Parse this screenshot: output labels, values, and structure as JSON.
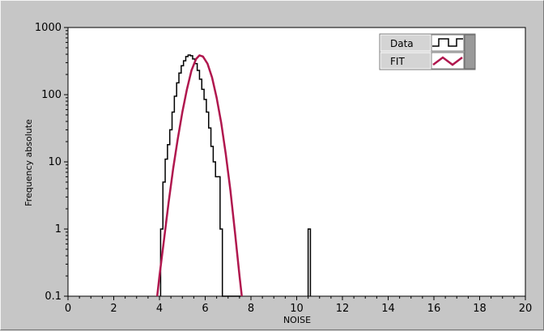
{
  "chart_data": {
    "type": "line",
    "title": "",
    "xlabel": "NOISE",
    "ylabel": "Frequency absolute",
    "xlim": [
      0,
      20
    ],
    "ylim": [
      0.1,
      1000
    ],
    "yscale": "log",
    "grid": false,
    "legend_position": "top-right",
    "x_ticks": [
      0,
      2,
      4,
      6,
      8,
      10,
      12,
      14,
      16,
      18,
      20
    ],
    "y_ticks": [
      0.1,
      1,
      10,
      100,
      1000
    ],
    "x_tick_labels": [
      "0",
      "2",
      "4",
      "6",
      "8",
      "10",
      "12",
      "14",
      "16",
      "18",
      "20"
    ],
    "y_tick_labels": [
      "0.1",
      "1",
      "10",
      "100",
      "1000"
    ],
    "series": [
      {
        "name": "Data",
        "style": "step",
        "color": "#000000",
        "x": [
          4.1,
          4.2,
          4.3,
          4.4,
          4.5,
          4.6,
          4.7,
          4.8,
          4.9,
          5.0,
          5.1,
          5.2,
          5.3,
          5.4,
          5.5,
          5.6,
          5.7,
          5.8,
          5.9,
          6.0,
          6.1,
          6.2,
          6.3,
          6.4,
          6.5,
          6.6,
          6.7,
          6.8,
          6.9,
          7.0,
          7.1,
          7.2,
          7.3,
          7.4,
          7.5
        ],
        "y": [
          1,
          5,
          11,
          18,
          30,
          55,
          95,
          150,
          210,
          270,
          320,
          370,
          390,
          380,
          340,
          290,
          230,
          170,
          120,
          85,
          55,
          32,
          17,
          10,
          6,
          6,
          1,
          0.1,
          0.1,
          0.1,
          0.1,
          0.1,
          0.1,
          0.1,
          0.1
        ],
        "outliers": [
          {
            "x": 10.55,
            "y": 1
          }
        ]
      },
      {
        "name": "FIT",
        "style": "line",
        "color": "#b0174e",
        "x": [
          3.9,
          4.0,
          4.2,
          4.4,
          4.6,
          4.8,
          5.0,
          5.2,
          5.4,
          5.6,
          5.75,
          5.9,
          6.1,
          6.3,
          6.5,
          6.7,
          6.9,
          7.1,
          7.3,
          7.5,
          7.6
        ],
        "y": [
          0.1,
          0.2,
          0.7,
          2.5,
          8,
          22,
          55,
          120,
          230,
          340,
          385,
          370,
          290,
          180,
          90,
          38,
          13,
          3.8,
          0.9,
          0.2,
          0.1
        ]
      }
    ]
  },
  "legend": {
    "items": [
      {
        "label": "Data",
        "icon": "step-line-icon",
        "color": "#000000"
      },
      {
        "label": "FIT",
        "icon": "zigzag-line-icon",
        "color": "#b0174e"
      }
    ]
  }
}
